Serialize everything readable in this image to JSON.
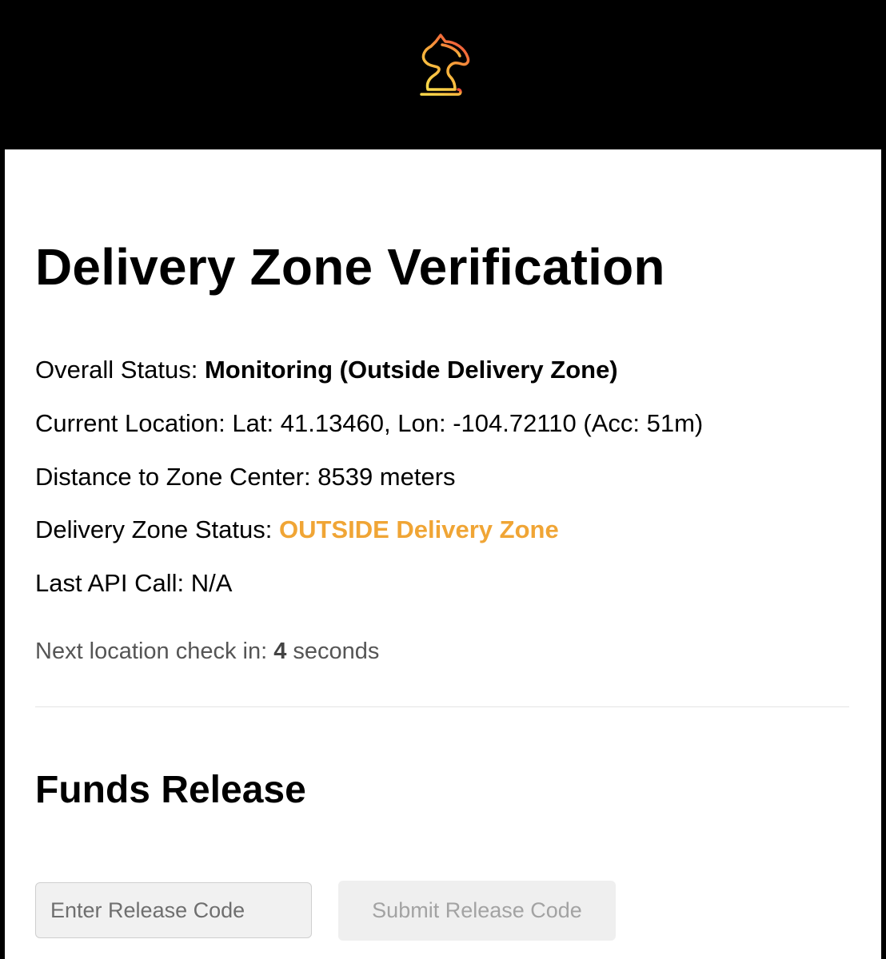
{
  "header": {
    "logo_icon": "knight-chess-piece-icon",
    "logo_gradient": [
      "#f04a3a",
      "#f7a93a",
      "#f9d84a"
    ]
  },
  "verification": {
    "title": "Delivery Zone Verification",
    "overall_status_label": "Overall Status:",
    "overall_status_value": "Monitoring (Outside Delivery Zone)",
    "current_location": "Current Location: Lat: 41.13460, Lon: -104.72110 (Acc: 51m)",
    "distance": "Distance to Zone Center: 8539 meters",
    "zone_status_label": "Delivery Zone Status:",
    "zone_status_value": "OUTSIDE Delivery Zone",
    "zone_status_color": "#f0a535",
    "last_api_call": "Last API Call: N/A",
    "next_check_prefix": "Next location check in:",
    "next_check_seconds": "4",
    "next_check_suffix": "seconds"
  },
  "funds_release": {
    "title": "Funds Release",
    "code_input_placeholder": "Enter Release Code",
    "code_input_value": "",
    "submit_label": "Submit Release Code"
  }
}
